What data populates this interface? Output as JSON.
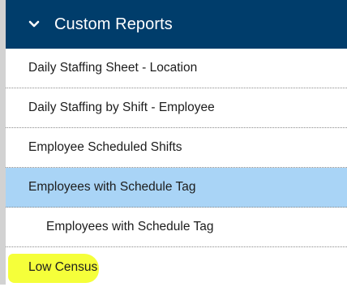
{
  "section": {
    "title": "Custom Reports",
    "expanded": true,
    "icon": "chevron-down-icon",
    "header_color": "#003d6b"
  },
  "items": [
    {
      "label": "Daily Staffing Sheet - Location"
    },
    {
      "label": "Daily Staffing by Shift - Employee"
    },
    {
      "label": "Employee Scheduled Shifts"
    },
    {
      "label": "Employees with Schedule Tag",
      "selected": true
    },
    {
      "label": "Employees with Schedule Tag",
      "indent": true
    },
    {
      "label": "Low Census",
      "highlighted": true
    }
  ],
  "colors": {
    "selected_row": "#a9d4f6",
    "highlight_marker": "#f5ff3a"
  }
}
